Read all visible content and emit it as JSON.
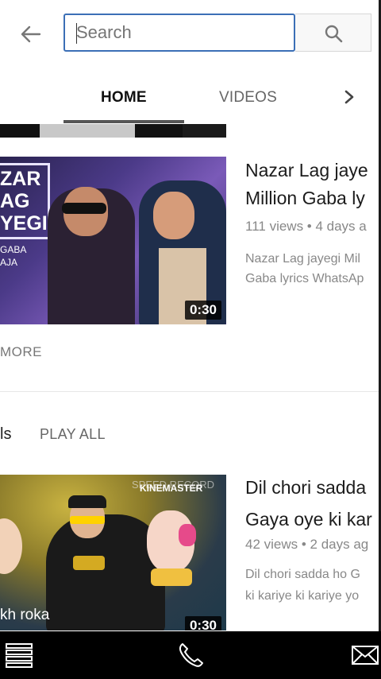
{
  "search": {
    "placeholder": "Search"
  },
  "tabs": [
    {
      "label": "HOME"
    },
    {
      "label": "VIDEOS"
    }
  ],
  "videos": [
    {
      "title_line1": "Nazar Lag jaye",
      "title_line2": "Million Gaba ly",
      "meta": "111 views • 4 days a",
      "desc_line1": "Nazar Lag jayegi Mil",
      "desc_line2": "Gaba lyrics WhatsAp",
      "duration": "0:30",
      "thumb_text": [
        "ZAR",
        "AG",
        "YEGI",
        "GABA",
        "AJA"
      ]
    },
    {
      "title_line1": "Dil chori sadda",
      "title_line2": "Gaya oye ki kar",
      "meta": "42 views • 2 days ag",
      "desc_line1": "Dil chori sadda ho G",
      "desc_line2": "ki kariye ki kariye yo",
      "duration": "0:30",
      "thumb_text": [
        "SPEED RECORD",
        "KINEMASTER",
        "kh roka"
      ]
    }
  ],
  "more_label": "MORE",
  "shelf": {
    "title_fragment": "ls",
    "play_all": "PLAY ALL"
  },
  "icons": {
    "back": "arrow-left-icon",
    "search": "search-icon",
    "tabs_next": "chevron-right-icon",
    "menu": "menu-icon",
    "phone": "phone-icon",
    "mail": "mail-icon"
  },
  "colors": {
    "search_border": "#3b6fb6",
    "tab_underline": "#555555",
    "navbar_bg": "#000000"
  }
}
